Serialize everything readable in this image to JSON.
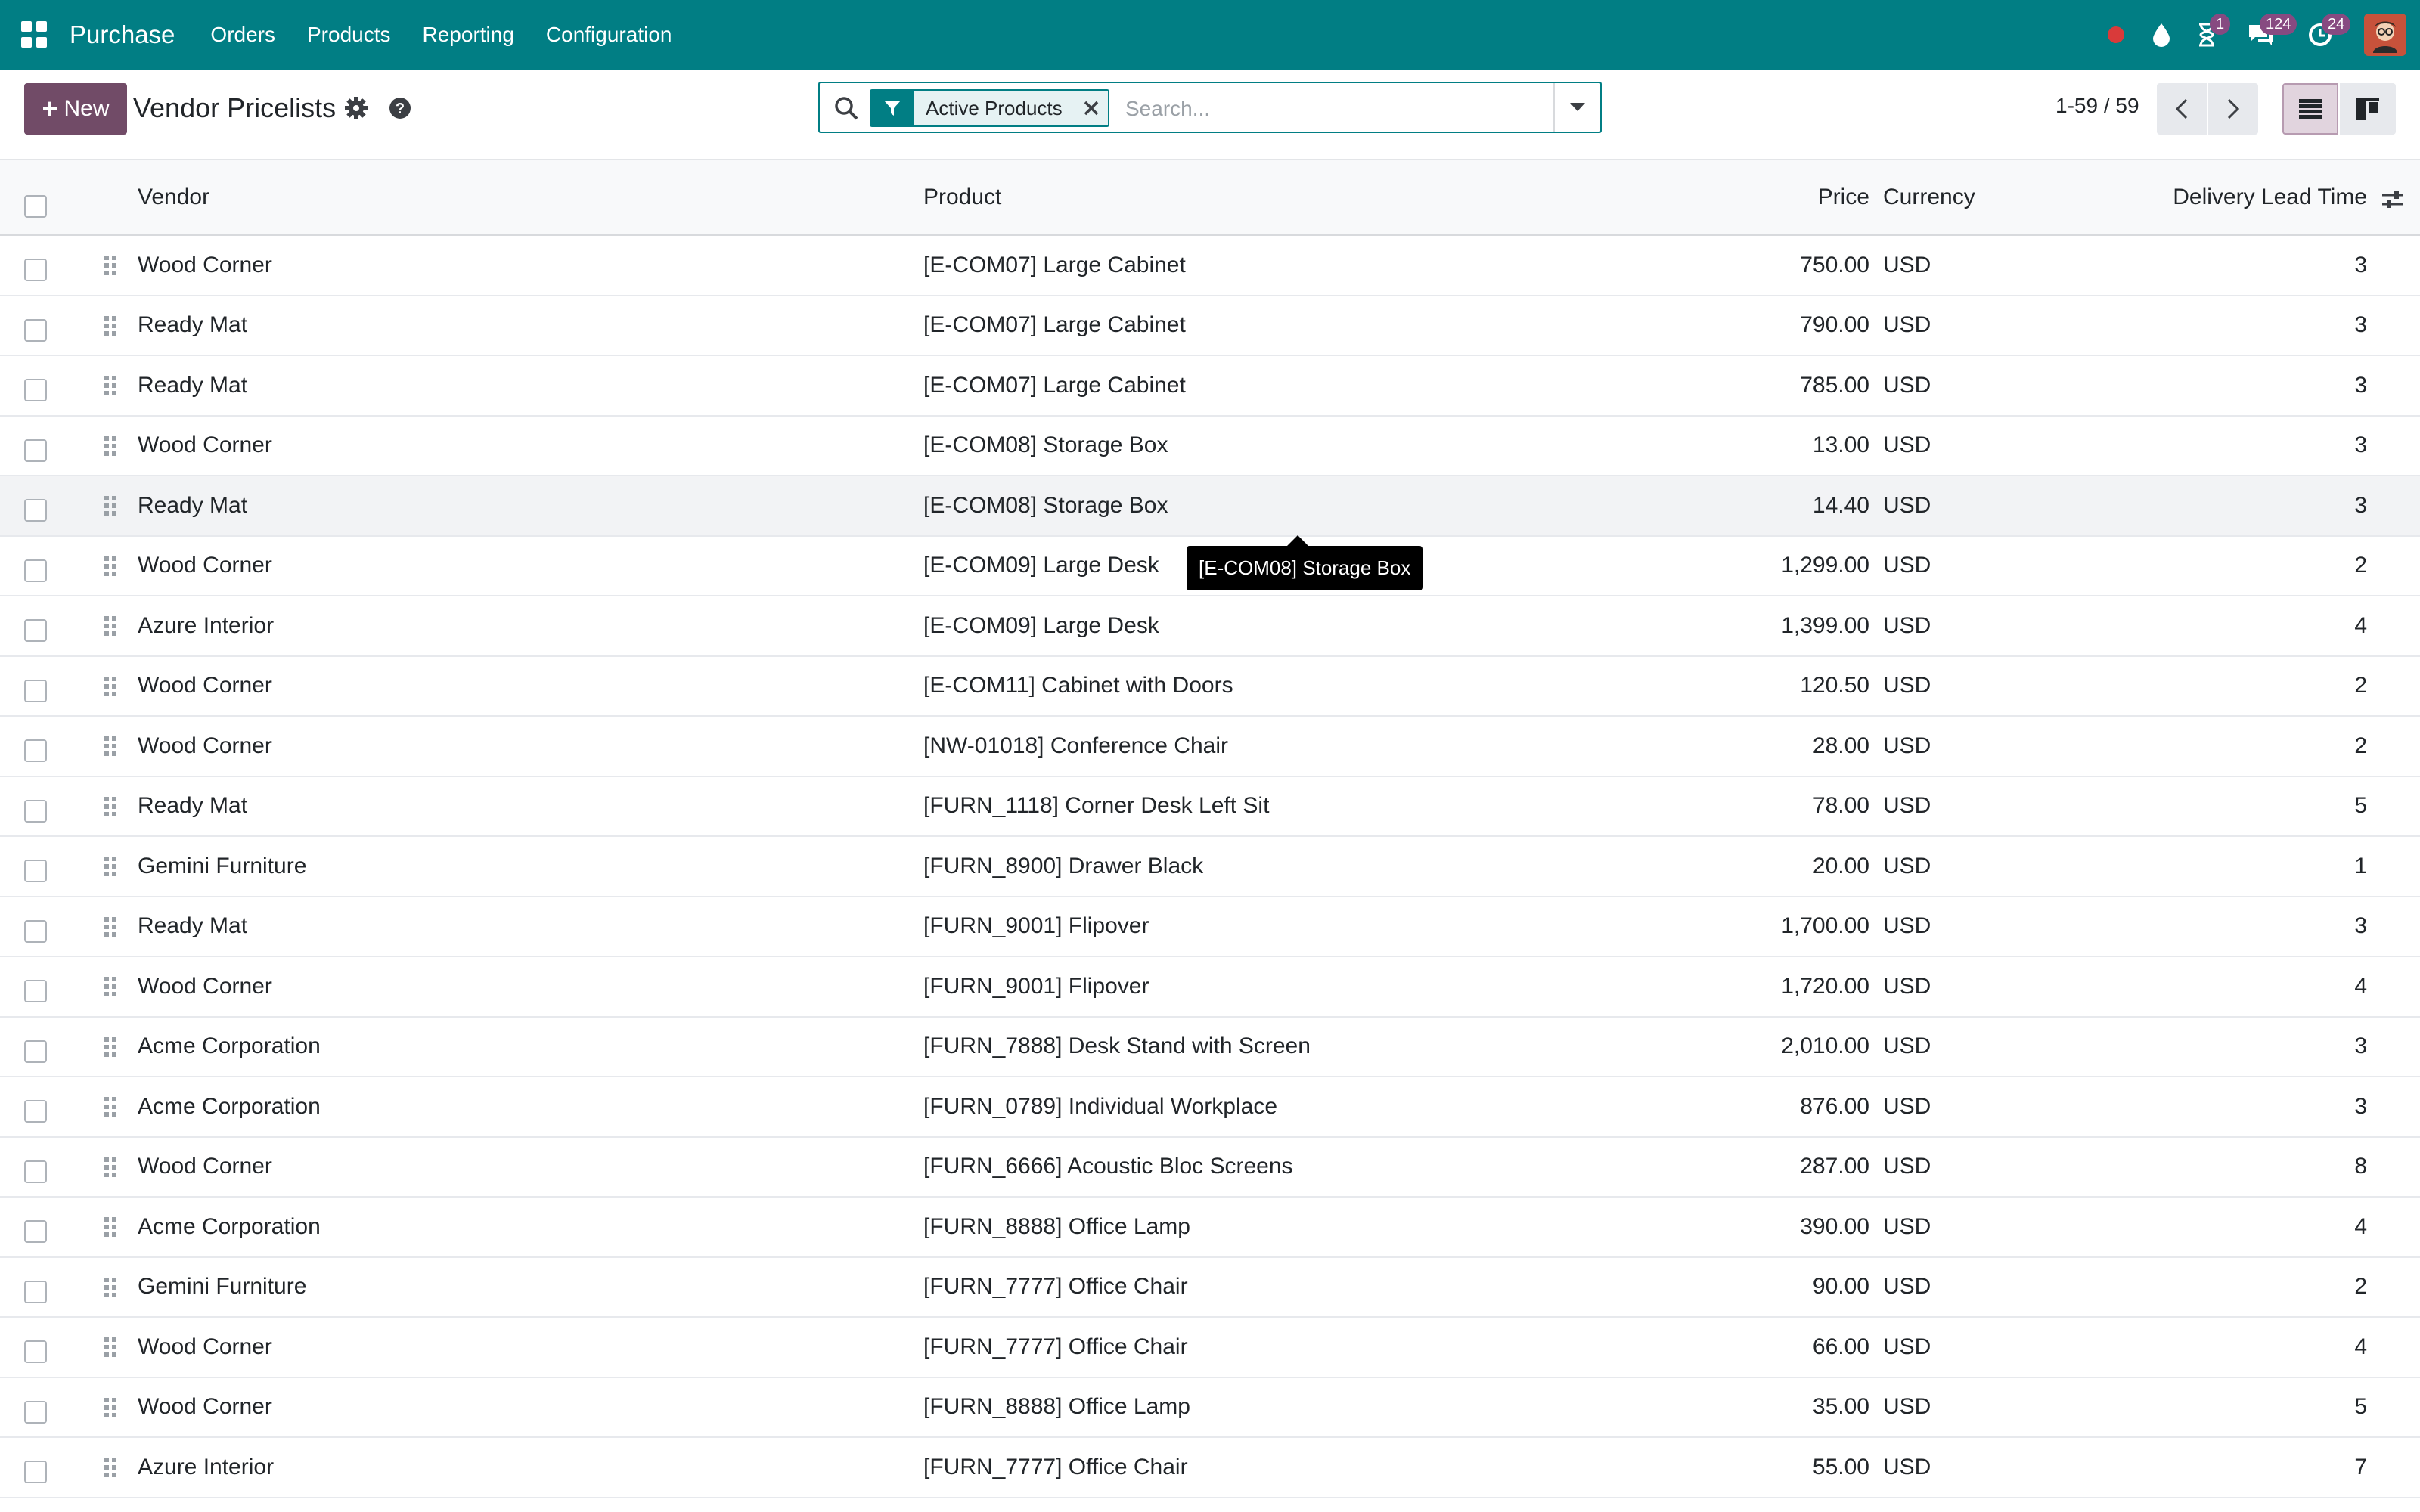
{
  "navbar": {
    "app_name": "Purchase",
    "menus": [
      "Orders",
      "Products",
      "Reporting",
      "Configuration"
    ],
    "activity_badge": "1",
    "messages_badge": "124",
    "clock_badge": "24",
    "accent_color": "#017e84",
    "badge_color": "#874a81"
  },
  "control": {
    "new_button": "New",
    "title": "Vendor Pricelists",
    "search": {
      "facet": "Active Products",
      "placeholder": "Search..."
    },
    "pager": "1-59 / 59",
    "primary_color": "#714b67"
  },
  "table": {
    "columns": {
      "vendor": "Vendor",
      "product": "Product",
      "price": "Price",
      "currency": "Currency",
      "lead_time": "Delivery Lead Time"
    },
    "rows": [
      {
        "vendor": "Wood Corner",
        "product": "[E-COM07] Large Cabinet",
        "price": "750.00",
        "currency": "USD",
        "lead_time": "3"
      },
      {
        "vendor": "Ready Mat",
        "product": "[E-COM07] Large Cabinet",
        "price": "790.00",
        "currency": "USD",
        "lead_time": "3"
      },
      {
        "vendor": "Ready Mat",
        "product": "[E-COM07] Large Cabinet",
        "price": "785.00",
        "currency": "USD",
        "lead_time": "3"
      },
      {
        "vendor": "Wood Corner",
        "product": "[E-COM08] Storage Box",
        "price": "13.00",
        "currency": "USD",
        "lead_time": "3"
      },
      {
        "vendor": "Ready Mat",
        "product": "[E-COM08] Storage Box",
        "price": "14.40",
        "currency": "USD",
        "lead_time": "3"
      },
      {
        "vendor": "Wood Corner",
        "product": "[E-COM09] Large Desk",
        "price": "1,299.00",
        "currency": "USD",
        "lead_time": "2"
      },
      {
        "vendor": "Azure Interior",
        "product": "[E-COM09] Large Desk",
        "price": "1,399.00",
        "currency": "USD",
        "lead_time": "4"
      },
      {
        "vendor": "Wood Corner",
        "product": "[E-COM11] Cabinet with Doors",
        "price": "120.50",
        "currency": "USD",
        "lead_time": "2"
      },
      {
        "vendor": "Wood Corner",
        "product": "[NW-01018] Conference Chair",
        "price": "28.00",
        "currency": "USD",
        "lead_time": "2"
      },
      {
        "vendor": "Ready Mat",
        "product": "[FURN_1118] Corner Desk Left Sit",
        "price": "78.00",
        "currency": "USD",
        "lead_time": "5"
      },
      {
        "vendor": "Gemini Furniture",
        "product": "[FURN_8900] Drawer Black",
        "price": "20.00",
        "currency": "USD",
        "lead_time": "1"
      },
      {
        "vendor": "Ready Mat",
        "product": "[FURN_9001] Flipover",
        "price": "1,700.00",
        "currency": "USD",
        "lead_time": "3"
      },
      {
        "vendor": "Wood Corner",
        "product": "[FURN_9001] Flipover",
        "price": "1,720.00",
        "currency": "USD",
        "lead_time": "4"
      },
      {
        "vendor": "Acme Corporation",
        "product": "[FURN_7888] Desk Stand with Screen",
        "price": "2,010.00",
        "currency": "USD",
        "lead_time": "3"
      },
      {
        "vendor": "Acme Corporation",
        "product": "[FURN_0789] Individual Workplace",
        "price": "876.00",
        "currency": "USD",
        "lead_time": "3"
      },
      {
        "vendor": "Wood Corner",
        "product": "[FURN_6666] Acoustic Bloc Screens",
        "price": "287.00",
        "currency": "USD",
        "lead_time": "8"
      },
      {
        "vendor": "Acme Corporation",
        "product": "[FURN_8888] Office Lamp",
        "price": "390.00",
        "currency": "USD",
        "lead_time": "4"
      },
      {
        "vendor": "Gemini Furniture",
        "product": "[FURN_7777] Office Chair",
        "price": "90.00",
        "currency": "USD",
        "lead_time": "2"
      },
      {
        "vendor": "Wood Corner",
        "product": "[FURN_7777] Office Chair",
        "price": "66.00",
        "currency": "USD",
        "lead_time": "4"
      },
      {
        "vendor": "Wood Corner",
        "product": "[FURN_8888] Office Lamp",
        "price": "35.00",
        "currency": "USD",
        "lead_time": "5"
      },
      {
        "vendor": "Azure Interior",
        "product": "[FURN_7777] Office Chair",
        "price": "55.00",
        "currency": "USD",
        "lead_time": "7"
      }
    ],
    "hovered_row": 4
  },
  "tooltip": {
    "text": "[E-COM08] Storage Box"
  }
}
